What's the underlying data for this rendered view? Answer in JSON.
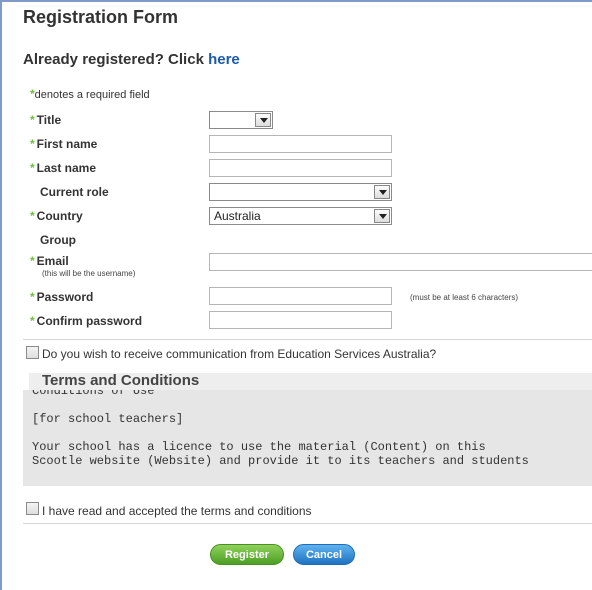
{
  "form": {
    "title": "Registration Form",
    "already_registered": "Already registered? Click ",
    "here_link": "here",
    "required_star": "*",
    "required_note": "denotes a required field"
  },
  "fields": {
    "title_label": "Title",
    "title_value": "",
    "first_name_label": "First name",
    "last_name_label": "Last name",
    "current_role_label": "Current role",
    "current_role_value": "",
    "country_label": "Country",
    "country_value": "Australia",
    "group_label": "Group",
    "email_label": "Email",
    "email_sublabel": "(this will be the username)",
    "password_label": "Password",
    "password_hint": "(must be at least 6 characters)",
    "confirm_password_label": "Confirm password"
  },
  "communication": {
    "label": "Do you wish to receive communication from Education Services Australia?",
    "checked": false
  },
  "terms": {
    "heading": "Terms and Conditions",
    "text": "Conditions of Use\n\n[for school teachers]\n\nYour school has a licence to use the material (Content) on this\nScootle website (Website) and provide it to its teachers and students",
    "accept_label": "I have read and accepted the terms and conditions",
    "accepted": false
  },
  "buttons": {
    "register": "Register",
    "cancel": "Cancel"
  },
  "colors": {
    "required_star": "#6cbf3b",
    "link": "#1d5aa8",
    "register_button": "#4c9e25",
    "cancel_button": "#1f73c2"
  }
}
